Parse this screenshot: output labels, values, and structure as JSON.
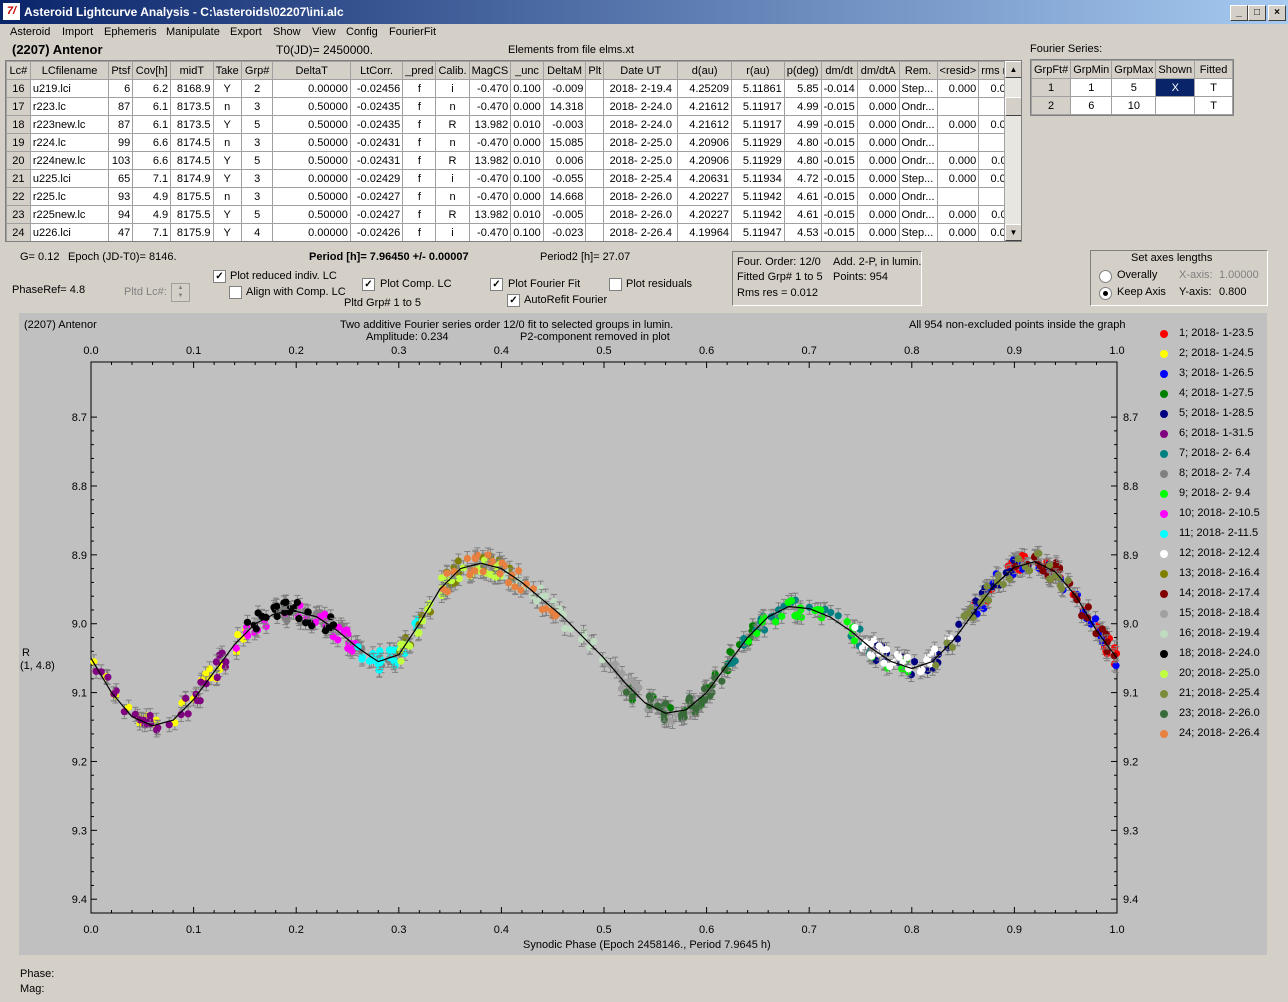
{
  "window": {
    "title": "Asteroid Lightcurve Analysis - C:\\asteroids\\02207\\ini.alc",
    "icon": "7/"
  },
  "menu": [
    "Asteroid",
    "Import",
    "Ephemeris",
    "Manipulate",
    "Export",
    "Show",
    "View",
    "Config",
    "FourierFit"
  ],
  "asteroid_name": "(2207) Antenor",
  "t0": "T0(JD)= 2450000.",
  "elements": "Elements from file elms.xt",
  "lc_table": {
    "headers": [
      "Lc#",
      "LCfilename",
      "Ptsf",
      "Cov[h]",
      "midT",
      "Take",
      "Grp#",
      "DeltaT",
      "LtCorr.",
      "_pred",
      "Calib.",
      "MagCS",
      "_unc",
      "DeltaM",
      "Plt",
      "Date UT",
      "d(au)",
      "r(au)",
      "p(deg)",
      "dm/dt",
      "dm/dtA",
      "Rem.",
      "<resid>",
      "rms res"
    ],
    "rows": [
      [
        "16",
        "u219.lci",
        "6",
        "6.2",
        "8168.9",
        "Y",
        "2",
        "0.00000",
        "-0.02456",
        "f",
        "i",
        "-0.470",
        "0.100",
        "-0.009",
        "",
        "2018- 2-19.4",
        "4.25209",
        "5.11861",
        "5.85",
        "-0.014",
        "0.000",
        "Step...",
        "0.000",
        "0.007"
      ],
      [
        "17",
        "r223.lc",
        "87",
        "6.1",
        "8173.5",
        "n",
        "3",
        "0.50000",
        "-0.02435",
        "f",
        "n",
        "-0.470",
        "0.000",
        "14.318",
        "",
        "2018- 2-24.0",
        "4.21612",
        "5.11917",
        "4.99",
        "-0.015",
        "0.000",
        "Ondr...",
        "",
        ""
      ],
      [
        "18",
        "r223new.lc",
        "87",
        "6.1",
        "8173.5",
        "Y",
        "5",
        "0.50000",
        "-0.02435",
        "f",
        "R",
        "13.982",
        "0.010",
        "-0.003",
        "",
        "2018- 2-24.0",
        "4.21612",
        "5.11917",
        "4.99",
        "-0.015",
        "0.000",
        "Ondr...",
        "0.000",
        "0.010"
      ],
      [
        "19",
        "r224.lc",
        "99",
        "6.6",
        "8174.5",
        "n",
        "3",
        "0.50000",
        "-0.02431",
        "f",
        "n",
        "-0.470",
        "0.000",
        "15.085",
        "",
        "2018- 2-25.0",
        "4.20906",
        "5.11929",
        "4.80",
        "-0.015",
        "0.000",
        "Ondr...",
        "",
        ""
      ],
      [
        "20",
        "r224new.lc",
        "103",
        "6.6",
        "8174.5",
        "Y",
        "5",
        "0.50000",
        "-0.02431",
        "f",
        "R",
        "13.982",
        "0.010",
        "0.006",
        "",
        "2018- 2-25.0",
        "4.20906",
        "5.11929",
        "4.80",
        "-0.015",
        "0.000",
        "Ondr...",
        "0.000",
        "0.011"
      ],
      [
        "21",
        "u225.lci",
        "65",
        "7.1",
        "8174.9",
        "Y",
        "3",
        "0.00000",
        "-0.02429",
        "f",
        "i",
        "-0.470",
        "0.100",
        "-0.055",
        "",
        "2018- 2-25.4",
        "4.20631",
        "5.11934",
        "4.72",
        "-0.015",
        "0.000",
        "Step...",
        "0.000",
        "0.013"
      ],
      [
        "22",
        "r225.lc",
        "93",
        "4.9",
        "8175.5",
        "n",
        "3",
        "0.50000",
        "-0.02427",
        "f",
        "n",
        "-0.470",
        "0.000",
        "14.668",
        "",
        "2018- 2-26.0",
        "4.20227",
        "5.11942",
        "4.61",
        "-0.015",
        "0.000",
        "Ondr...",
        "",
        ""
      ],
      [
        "23",
        "r225new.lc",
        "94",
        "4.9",
        "8175.5",
        "Y",
        "5",
        "0.50000",
        "-0.02427",
        "f",
        "R",
        "13.982",
        "0.010",
        "-0.005",
        "",
        "2018- 2-26.0",
        "4.20227",
        "5.11942",
        "4.61",
        "-0.015",
        "0.000",
        "Ondr...",
        "0.000",
        "0.011"
      ],
      [
        "24",
        "u226.lci",
        "47",
        "7.1",
        "8175.9",
        "Y",
        "4",
        "0.00000",
        "-0.02426",
        "f",
        "i",
        "-0.470",
        "0.100",
        "-0.023",
        "",
        "2018- 2-26.4",
        "4.19964",
        "5.11947",
        "4.53",
        "-0.015",
        "0.000",
        "Step...",
        "0.000",
        "0.013"
      ]
    ]
  },
  "fourier_series": {
    "label": "Fourier Series:",
    "headers": [
      "GrpFt#",
      "GrpMin",
      "GrpMax",
      "Shown",
      "Fitted"
    ],
    "rows": [
      [
        "1",
        "1",
        "5",
        "X",
        "T"
      ],
      [
        "2",
        "6",
        "10",
        "",
        "T"
      ]
    ]
  },
  "params": {
    "g": "G= 0.12",
    "epoch": "Epoch (JD-T0)= 8146.",
    "period": "Period [h]= 7.96450 +/- 0.00007",
    "period2": "Period2 [h]= 27.07",
    "phaseref": "PhaseRef= 4.8",
    "pltd_lc": "Pltd Lc#:",
    "pltd_grp": "Pltd Grp#  1   to   5"
  },
  "checkboxes": {
    "plot_reduced": {
      "label": "Plot reduced indiv. LC",
      "checked": "✓"
    },
    "align_comp": {
      "label": "Align with Comp. LC",
      "checked": ""
    },
    "plot_comp": {
      "label": "Plot Comp. LC",
      "checked": "✓"
    },
    "plot_fourier": {
      "label": "Plot Fourier Fit",
      "checked": "✓"
    },
    "autorefit": {
      "label": "AutoRefit Fourier",
      "checked": "✓"
    },
    "plot_residuals": {
      "label": "Plot residuals",
      "checked": ""
    }
  },
  "fit_info": {
    "order": "Four. Order: 12/0",
    "add": "Add. 2-P, in lumin.",
    "fitted": "Fitted Grp# 1 to 5",
    "points": "Points: 954",
    "rms": "Rms res     = 0.012"
  },
  "axes_box": {
    "title": "Set axes lengths",
    "overally": "Overally",
    "keep": "Keep Axis",
    "xaxis_label": "X-axis:",
    "xaxis_value": "1.00000",
    "yaxis_label": "Y-axis:",
    "yaxis_value": "0.800"
  },
  "plot": {
    "corner_title": "(2207) Antenor",
    "title_line1": "Two additive Fourier series order 12/0 fit to selected groups in lumin.",
    "amplitude": "Amplitude: 0.234",
    "p2": "P2-component removed in plot",
    "all_points": "All 954 non-excluded points inside the graph",
    "ylabel1": "R",
    "ylabel2": "(1, 4.8)",
    "xlabel": "Synodic Phase (Epoch 2458146., Period 7.9645 h)"
  },
  "chart_data": {
    "type": "scatter",
    "xlabel": "Synodic Phase (Epoch 2458146., Period 7.9645 h)",
    "ylabel": "R",
    "xlim": [
      0,
      1
    ],
    "ylim": [
      9.42,
      8.62
    ],
    "x_ticks": [
      "0.0",
      "0.1",
      "0.2",
      "0.3",
      "0.4",
      "0.5",
      "0.6",
      "0.7",
      "0.8",
      "0.9",
      "1.0"
    ],
    "y_ticks": [
      8.7,
      8.8,
      8.9,
      9.0,
      9.1,
      9.2,
      9.3,
      9.4
    ],
    "y_tick_labels": [
      "8.7",
      "8.8",
      "8.9",
      "9.0",
      "9.1",
      "9.2",
      "9.3",
      "9.4"
    ],
    "fourier_curve": {
      "x": [
        0.0,
        0.02,
        0.04,
        0.06,
        0.08,
        0.1,
        0.12,
        0.14,
        0.16,
        0.18,
        0.2,
        0.22,
        0.24,
        0.26,
        0.28,
        0.3,
        0.32,
        0.34,
        0.36,
        0.38,
        0.4,
        0.42,
        0.44,
        0.46,
        0.48,
        0.5,
        0.52,
        0.54,
        0.56,
        0.58,
        0.6,
        0.62,
        0.64,
        0.66,
        0.68,
        0.7,
        0.72,
        0.74,
        0.76,
        0.78,
        0.8,
        0.82,
        0.84,
        0.86,
        0.88,
        0.9,
        0.92,
        0.94,
        0.96,
        0.98,
        1.0
      ],
      "y": [
        9.05,
        9.1,
        9.135,
        9.148,
        9.14,
        9.11,
        9.07,
        9.03,
        9.0,
        8.985,
        8.982,
        8.99,
        9.01,
        9.035,
        9.055,
        9.045,
        9.0,
        8.95,
        8.92,
        8.912,
        8.92,
        8.94,
        8.965,
        8.99,
        9.02,
        9.05,
        9.085,
        9.115,
        9.13,
        9.125,
        9.1,
        9.06,
        9.02,
        8.99,
        8.975,
        8.978,
        8.99,
        9.01,
        9.035,
        9.055,
        9.065,
        9.055,
        9.025,
        8.985,
        8.945,
        8.918,
        8.91,
        8.925,
        8.96,
        9.01,
        9.05
      ]
    },
    "series": [
      {
        "name": "1; 2018- 1-23.5",
        "color": "#ff0000",
        "x_range": [
          0.86,
          1.0
        ]
      },
      {
        "name": "2; 2018- 1-24.5",
        "color": "#ffff00",
        "x_range": [
          0.0,
          0.16
        ]
      },
      {
        "name": "3; 2018- 1-26.5",
        "color": "#0000ff",
        "x_range": [
          0.86,
          1.0
        ]
      },
      {
        "name": "4; 2018- 1-27.5",
        "color": "#008000",
        "x_range": [
          0.52,
          0.66
        ]
      },
      {
        "name": "5; 2018- 1-28.5",
        "color": "#000080",
        "x_range": [
          0.76,
          0.92
        ]
      },
      {
        "name": "6; 2018- 1-31.5",
        "color": "#800080",
        "x_range": [
          0.0,
          0.14
        ]
      },
      {
        "name": "7; 2018- 2- 6.4",
        "color": "#008080",
        "x_range": [
          0.62,
          0.76
        ]
      },
      {
        "name": "8; 2018- 2- 7.4",
        "color": "#808080",
        "x_range": [
          0.18,
          0.3
        ]
      },
      {
        "name": "9; 2018- 2- 9.4",
        "color": "#00ff00",
        "x_range": [
          0.64,
          0.8
        ]
      },
      {
        "name": "10; 2018- 2-10.5",
        "color": "#ff00ff",
        "x_range": [
          0.14,
          0.26
        ]
      },
      {
        "name": "11; 2018- 2-11.5",
        "color": "#00ffff",
        "x_range": [
          0.26,
          0.32
        ]
      },
      {
        "name": "12; 2018- 2-12.4",
        "color": "#ffffff",
        "x_range": [
          0.74,
          0.84
        ]
      },
      {
        "name": "13; 2018- 2-16.4",
        "color": "#808000",
        "x_range": [
          0.3,
          0.42
        ]
      },
      {
        "name": "14; 2018- 2-17.4",
        "color": "#800000",
        "x_range": [
          0.9,
          1.0
        ]
      },
      {
        "name": "15; 2018- 2-18.4",
        "color": "#a0a0a0",
        "x_range": [
          0.5,
          0.6
        ]
      },
      {
        "name": "16; 2018- 2-19.4",
        "color": "#c0dcc0",
        "x_range": [
          0.4,
          0.5
        ]
      },
      {
        "name": "18; 2018- 2-24.0",
        "color": "#000000",
        "x_range": [
          0.14,
          0.24
        ]
      },
      {
        "name": "20; 2018- 2-25.0",
        "color": "#c0ff40",
        "x_range": [
          0.3,
          0.4
        ]
      },
      {
        "name": "21; 2018- 2-25.4",
        "color": "#7b8b3c",
        "x_range": [
          0.82,
          0.96
        ]
      },
      {
        "name": "23; 2018- 2-26.0",
        "color": "#3a6b3a",
        "x_range": [
          0.52,
          0.62
        ]
      },
      {
        "name": "24; 2018- 2-26.4",
        "color": "#e88040",
        "x_range": [
          0.34,
          0.46
        ]
      }
    ]
  },
  "status": {
    "phase": "Phase:",
    "mag": "Mag:"
  }
}
